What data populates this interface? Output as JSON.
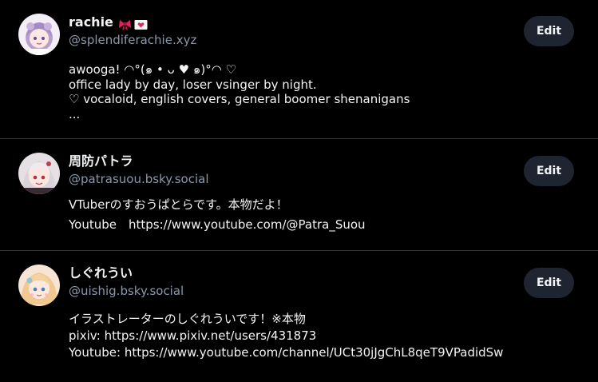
{
  "colors": {
    "background": "#000000",
    "divider": "#2e3643",
    "handle": "#8b98a9",
    "text": "#f1f3f5",
    "button_bg": "#1e2530"
  },
  "profiles": [
    {
      "display_name": "rachie",
      "badge_icons": [
        "ribbon-icon",
        "heart-letter-icon"
      ],
      "handle": "@splendiferachie.xyz",
      "edit_label": "Edit",
      "bio_lines": [
        "awooga! ◠°(๑ • ᴗ ♥ ๑)°◠ ♡",
        "office lady by day, loser vsinger by night.",
        "♡ vocaloid, english covers, general boomer shenanigans",
        "..."
      ]
    },
    {
      "display_name": "周防パトラ",
      "handle": "@patrasuou.bsky.social",
      "edit_label": "Edit",
      "bio_lines": [
        "VTuberのすおうぱとらです。本物だよ！",
        "Youtube　https://www.youtube.com/@Patra_Suou"
      ]
    },
    {
      "display_name": "しぐれうい",
      "handle": "@uishig.bsky.social",
      "edit_label": "Edit",
      "bio_lines": [
        "イラストレーターのしぐれういです！※本物",
        "pixiv: https://www.pixiv.net/users/431873",
        "Youtube: https://www.youtube.com/channel/UCt30jJgChL8qeT9VPadidSw"
      ]
    }
  ]
}
